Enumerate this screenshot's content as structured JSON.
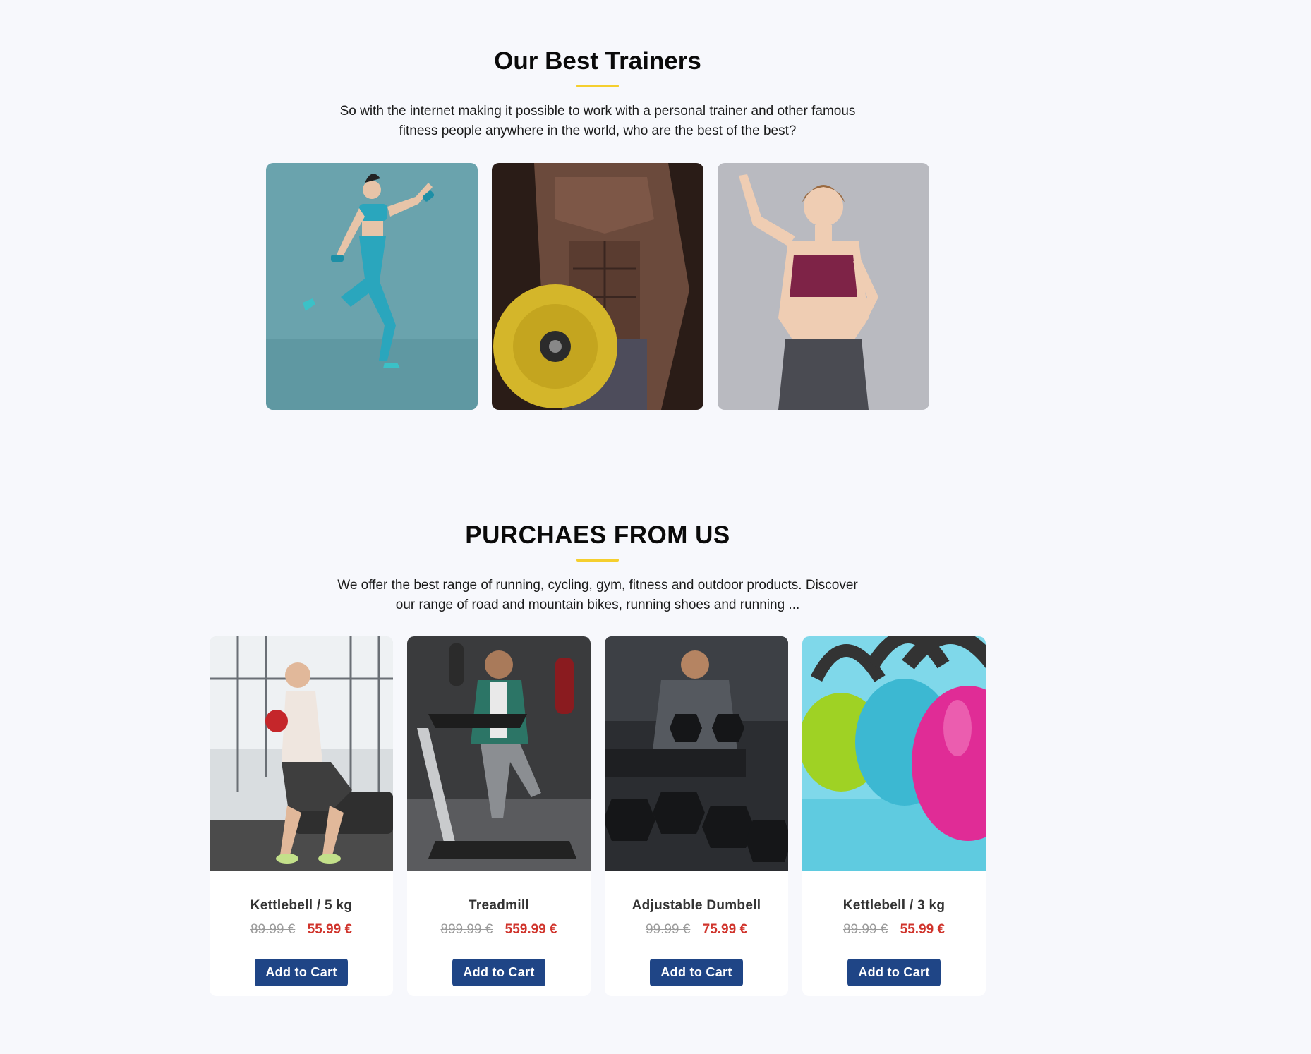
{
  "trainers": {
    "title": "Our Best Trainers",
    "description": "So with the internet making it possible to work with a personal trainer and other famous fitness people anywhere in the world, who are the best of the best?",
    "photos": [
      {
        "alt": "trainer-photo-1",
        "background": "#6aa3ad"
      },
      {
        "alt": "trainer-photo-2",
        "background": "#3b2a24"
      },
      {
        "alt": "trainer-photo-3",
        "background": "#b9bac0"
      }
    ]
  },
  "shop": {
    "title": "PURCHAES FROM US",
    "description": "We offer the best range of running, cycling, gym, fitness and outdoor products. Discover our range of road and mountain bikes, running shoes and running ...",
    "products": [
      {
        "name": "Kettlebell / 5 kg",
        "old_price": "89.99 €",
        "new_price": "55.99 €",
        "button": "Add to Cart"
      },
      {
        "name": "Treadmill",
        "old_price": "899.99 €",
        "new_price": "559.99 €",
        "button": "Add to Cart"
      },
      {
        "name": "Adjustable Dumbell",
        "old_price": "99.99 €",
        "new_price": "75.99 €",
        "button": "Add to Cart"
      },
      {
        "name": "Kettlebell / 3 kg",
        "old_price": "89.99 €",
        "new_price": "55.99 €",
        "button": "Add to Cart"
      }
    ]
  },
  "colors": {
    "background": "#f7f8fc",
    "accent_underline": "#f5cf2e",
    "button": "#1f4586",
    "sale_price": "#d0342c",
    "old_price": "#9b9b9b"
  }
}
